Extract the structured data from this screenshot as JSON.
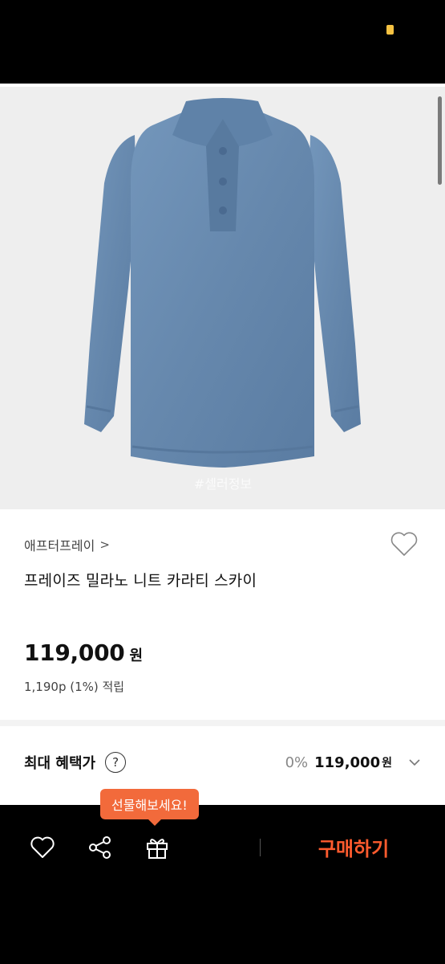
{
  "product": {
    "brand": "애프터프레이",
    "brand_chevron": ">",
    "name": "프레이즈 밀라노 니트 카라티 스카이",
    "price": "119,000",
    "price_unit": "원",
    "points": "1,190p (1%) 적립",
    "image_watermark": "#셀러정보"
  },
  "benefit": {
    "label": "최대 혜택가",
    "help_glyph": "?",
    "percent": "0%",
    "price": "119,000",
    "unit": "원"
  },
  "bottom_bar": {
    "gift_tooltip": "선물해보세요!",
    "buy_label": "구매하기",
    "icons": [
      "heart-icon",
      "share-icon",
      "gift-icon"
    ]
  },
  "colors": {
    "accent": "#ff5b2e",
    "tooltip": "#f26a3b",
    "sweater": "#6b8fb3"
  }
}
